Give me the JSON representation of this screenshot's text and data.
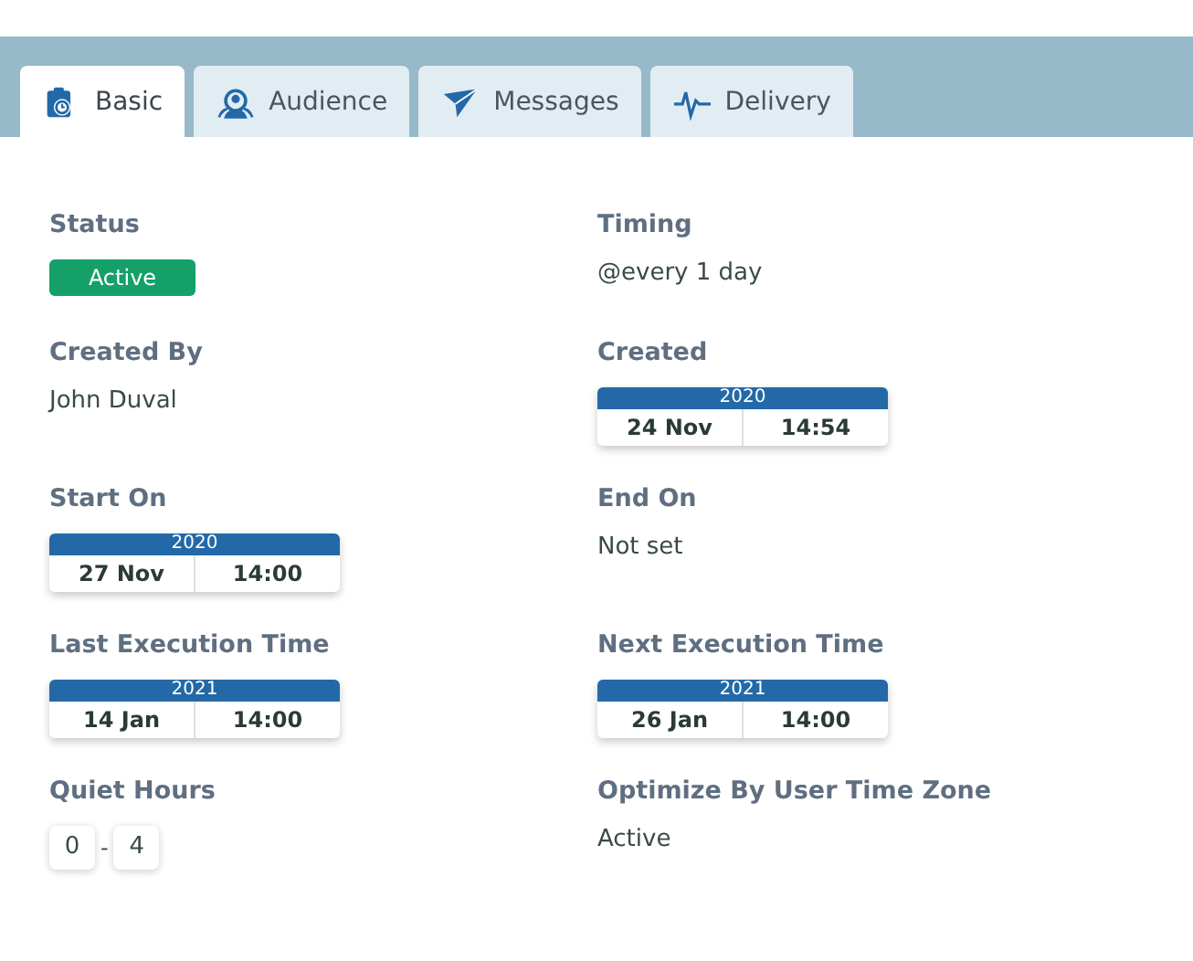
{
  "tabs": [
    {
      "label": "Basic",
      "selected": true
    },
    {
      "label": "Audience",
      "selected": false
    },
    {
      "label": "Messages",
      "selected": false
    },
    {
      "label": "Delivery",
      "selected": false
    }
  ],
  "fields": [
    {
      "label": "Status",
      "kind": "badge",
      "value": "Active"
    },
    {
      "label": "Timing",
      "kind": "text",
      "value": "@every 1 day"
    },
    {
      "label": "Created By",
      "kind": "text",
      "value": "John Duval"
    },
    {
      "label": "Created",
      "kind": "date",
      "year": "2020",
      "date": "24 Nov",
      "time": "14:54"
    },
    {
      "label": "Start On",
      "kind": "date",
      "year": "2020",
      "date": "27 Nov",
      "time": "14:00"
    },
    {
      "label": "End On",
      "kind": "text",
      "value": "Not set"
    },
    {
      "label": "Last Execution Time",
      "kind": "date",
      "year": "2021",
      "date": "14 Jan",
      "time": "14:00"
    },
    {
      "label": "Next Execution Time",
      "kind": "date",
      "year": "2021",
      "date": "26 Jan",
      "time": "14:00"
    },
    {
      "label": "Quiet Hours",
      "kind": "hours",
      "from": "0",
      "separator": "-",
      "to": "4"
    },
    {
      "label": "Optimize By User Time Zone",
      "kind": "text",
      "value": "Active"
    }
  ]
}
